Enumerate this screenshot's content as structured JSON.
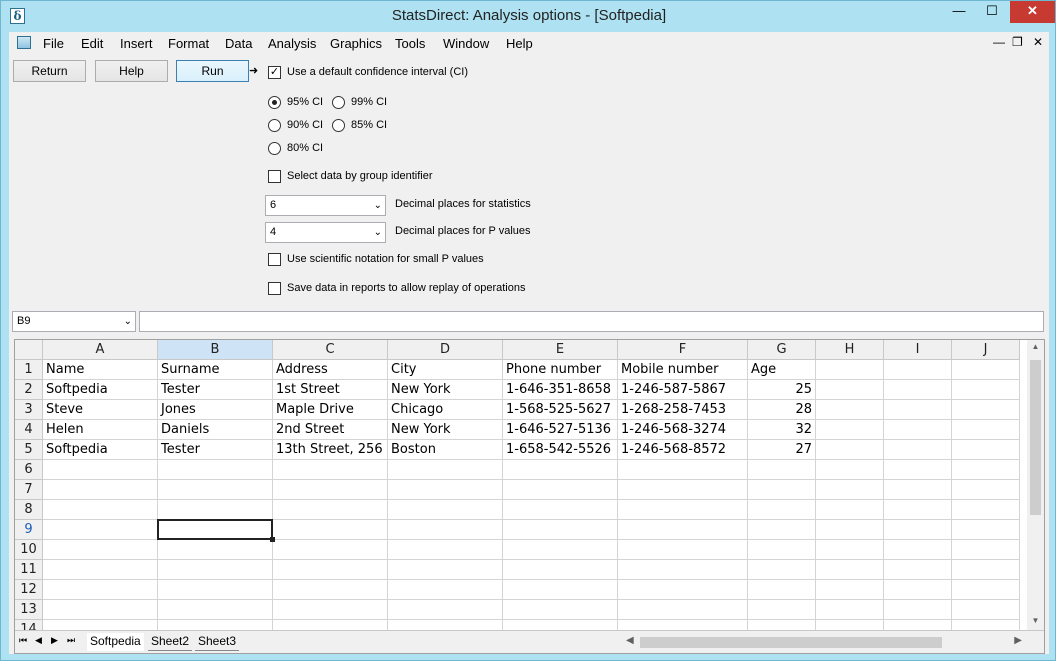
{
  "window": {
    "title": "StatsDirect: Analysis options - [Softpedia]",
    "app_icon_glyph": "δ",
    "min_glyph": "—",
    "max_glyph": "☐",
    "close_glyph": "✕"
  },
  "menubar": {
    "items": [
      "File",
      "Edit",
      "Insert",
      "Format",
      "Data",
      "Analysis",
      "Graphics",
      "Tools",
      "Window",
      "Help"
    ],
    "mdi_min": "—",
    "mdi_restore": "❐",
    "mdi_close": "✕"
  },
  "options": {
    "buttons": {
      "return": "Return",
      "help": "Help",
      "run": "Run"
    },
    "run_arrow": "➜",
    "use_default_ci": {
      "label": "Use a default confidence interval (CI)",
      "checked": true,
      "mark": "✓"
    },
    "ci_options": [
      {
        "label": "95% CI",
        "selected": true
      },
      {
        "label": "99% CI",
        "selected": false
      },
      {
        "label": "90% CI",
        "selected": false
      },
      {
        "label": "85% CI",
        "selected": false
      },
      {
        "label": "80% CI",
        "selected": false
      }
    ],
    "select_by_group": {
      "label": "Select data by group identifier",
      "checked": false
    },
    "decimal_stats": {
      "value": "6",
      "label": "Decimal places for statistics"
    },
    "decimal_p": {
      "value": "4",
      "label": "Decimal places for P values"
    },
    "scientific": {
      "label": "Use scientific notation for small P values",
      "checked": false
    },
    "save_replay": {
      "label": "Save data in reports to allow replay of operations",
      "checked": false
    },
    "dropdown_glyph": "⌄"
  },
  "formula_bar": {
    "cell_ref": "B9",
    "content": ""
  },
  "spreadsheet": {
    "columns": [
      "A",
      "B",
      "C",
      "D",
      "E",
      "F",
      "G",
      "H",
      "I",
      "J"
    ],
    "selected_column": "B",
    "selected_row": 9,
    "row_numbers": [
      1,
      2,
      3,
      4,
      5,
      6,
      7,
      8,
      9,
      10,
      11,
      12,
      13,
      14
    ],
    "rows": [
      [
        "Name",
        "Surname",
        "Address",
        "City",
        "Phone number",
        "Mobile number",
        "Age",
        "",
        "",
        ""
      ],
      [
        "Softpedia",
        "Tester",
        "1st Street",
        "New York",
        "1-646-351-8658",
        "1-246-587-5867",
        "25",
        "",
        "",
        ""
      ],
      [
        "Steve",
        "Jones",
        "Maple Drive",
        "Chicago",
        "1-568-525-5627",
        "1-268-258-7453",
        "28",
        "",
        "",
        ""
      ],
      [
        "Helen",
        "Daniels",
        "2nd Street",
        "New York",
        "1-646-527-5136",
        "1-246-568-3274",
        "32",
        "",
        "",
        ""
      ],
      [
        "Softpedia",
        "Tester",
        "13th Street, 256",
        "Boston",
        "1-658-542-5526",
        "1-246-568-8572",
        "27",
        "",
        "",
        ""
      ]
    ],
    "sheet_tabs": [
      "Softpedia",
      "Sheet2",
      "Sheet3"
    ],
    "active_tab": "Softpedia",
    "tab_nav": [
      "⏮",
      "◀",
      "▶",
      "⏭"
    ]
  }
}
